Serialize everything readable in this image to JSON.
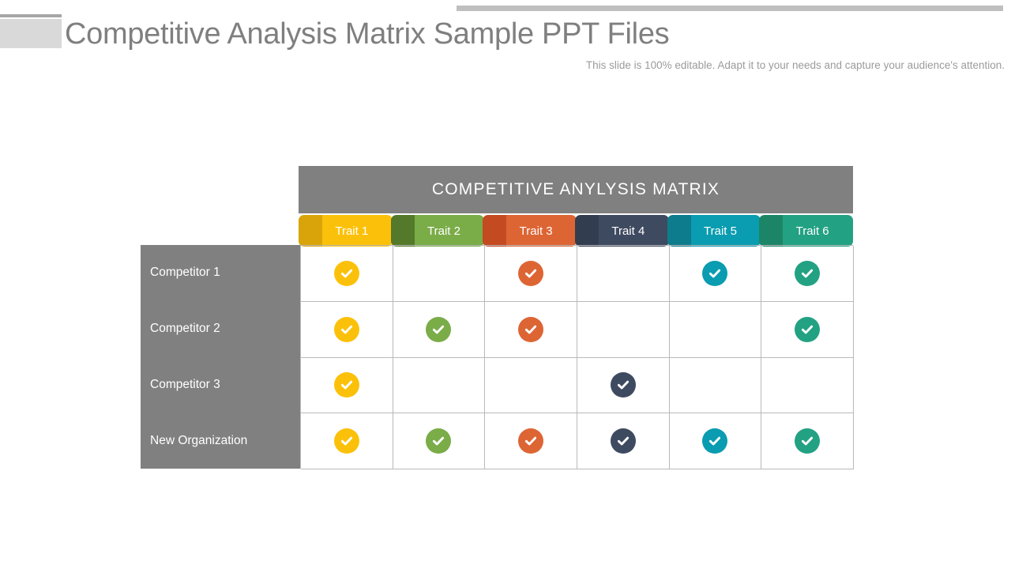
{
  "header": {
    "title": "Competitive Analysis Matrix Sample PPT Files",
    "subtitle": "This slide is 100% editable. Adapt it to your needs and capture your audience's attention."
  },
  "matrix": {
    "band_title": "COMPETITIVE ANYLYSIS MATRIX",
    "columns": [
      {
        "label": "Trait 1",
        "color": "#fbc10a",
        "dark": "#d9a40a"
      },
      {
        "label": "Trait 2",
        "color": "#7aac48",
        "dark": "#55792a"
      },
      {
        "label": "Trait 3",
        "color": "#dd6534",
        "dark": "#c44a22"
      },
      {
        "label": "Trait 4",
        "color": "#3e4a60",
        "dark": "#333d50"
      },
      {
        "label": "Trait 5",
        "color": "#0a9cb0",
        "dark": "#0d7c8c"
      },
      {
        "label": "Trait 6",
        "color": "#23a183",
        "dark": "#1d8567"
      }
    ],
    "rows": [
      {
        "label": "Competitor 1",
        "marks": [
          true,
          false,
          true,
          false,
          true,
          true
        ]
      },
      {
        "label": "Competitor 2",
        "marks": [
          true,
          true,
          true,
          false,
          false,
          true
        ]
      },
      {
        "label": "Competitor 3",
        "marks": [
          true,
          false,
          false,
          true,
          false,
          false
        ]
      },
      {
        "label": "New Organization",
        "marks": [
          true,
          true,
          true,
          true,
          true,
          true
        ]
      }
    ]
  },
  "colors": {
    "gray": "#808080",
    "rule": "#bfbfbf",
    "title_text": "#7f7f7f",
    "grid_line": "#b9b9b9"
  }
}
